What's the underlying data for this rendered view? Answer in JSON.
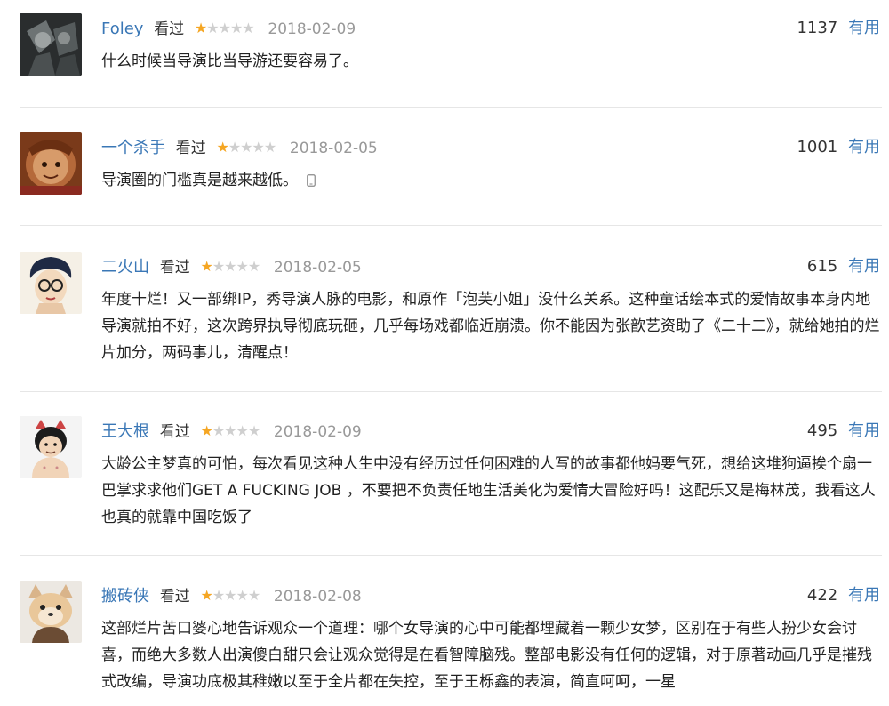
{
  "comments": [
    {
      "author": "Foley",
      "status": "看过",
      "rating": 1,
      "rating_max": 5,
      "date": "2018-02-09",
      "votes": "1137",
      "vote_label": "有用",
      "text": "什么时候当导演比当导游还要容易了。",
      "from_mobile": false
    },
    {
      "author": "一个杀手",
      "status": "看过",
      "rating": 1,
      "rating_max": 5,
      "date": "2018-02-05",
      "votes": "1001",
      "vote_label": "有用",
      "text": "导演圈的门槛真是越来越低。",
      "from_mobile": true
    },
    {
      "author": "二火山",
      "status": "看过",
      "rating": 1,
      "rating_max": 5,
      "date": "2018-02-05",
      "votes": "615",
      "vote_label": "有用",
      "text": "年度十烂！又一部绑IP，秀导演人脉的电影，和原作「泡芙小姐」没什么关系。这种童话绘本式的爱情故事本身内地导演就拍不好，这次跨界执导彻底玩砸，几乎每场戏都临近崩溃。你不能因为张歆艺资助了《二十二》，就给她拍的烂片加分，两码事儿，清醒点！",
      "from_mobile": false
    },
    {
      "author": "王大根",
      "status": "看过",
      "rating": 1,
      "rating_max": 5,
      "date": "2018-02-09",
      "votes": "495",
      "vote_label": "有用",
      "text": "大龄公主梦真的可怕，每次看见这种人生中没有经历过任何困难的人写的故事都他妈要气死，想给这堆狗逼挨个扇一巴掌求求他们GET A FUCKING JOB ，不要把不负责任地生活美化为爱情大冒险好吗！这配乐又是梅林茂，我看这人也真的就靠中国吃饭了",
      "from_mobile": false
    },
    {
      "author": "搬砖侠",
      "status": "看过",
      "rating": 1,
      "rating_max": 5,
      "date": "2018-02-08",
      "votes": "422",
      "vote_label": "有用",
      "text": "这部烂片苦口婆心地告诉观众一个道理：哪个女导演的心中可能都埋藏着一颗少女梦，区别在于有些人扮少女会讨喜，而绝大多数人出演傻白甜只会让观众觉得是在看智障脑残。整部电影没有任何的逻辑，对于原著动画几乎是摧残式改编，导演功底极其稚嫩以至于全片都在失控，至于王栎鑫的表演，简直呵呵，一星",
      "from_mobile": false
    }
  ],
  "colors": {
    "link": "#3a77b6",
    "star_on": "#f5a623",
    "star_off": "#cfcfcf",
    "date": "#999999",
    "divider": "#e6e6e6"
  }
}
